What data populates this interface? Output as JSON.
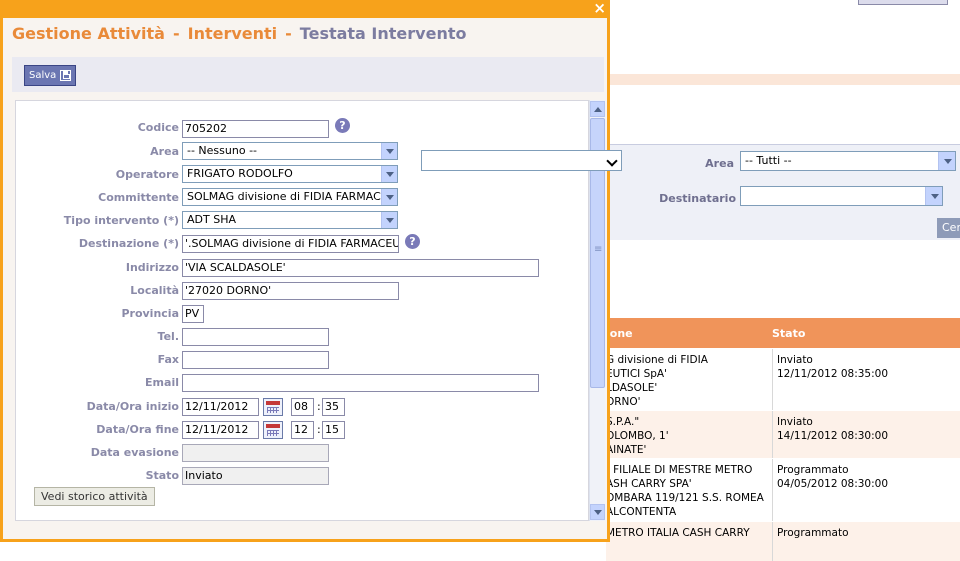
{
  "background": {
    "filter": {
      "area_label": "Area",
      "area_value": "-- Tutti --",
      "destinatario_label": "Destinatario",
      "destinatario_value": "",
      "search_button": "Cer"
    },
    "table": {
      "headers": [
        "ione",
        "Stato"
      ],
      "rows": [
        {
          "col1": [
            "G divisione di FIDIA",
            "EUTICI SpA'",
            "LDASOLE'",
            "ORNO'"
          ],
          "col2": [
            "Inviato",
            "12/11/2012 08:35:00"
          ]
        },
        {
          "col1": [
            "S.P.A.\"",
            "OLOMBO, 1'",
            "AINATE'"
          ],
          "col2": [
            "Inviato",
            "14/11/2012 08:30:00"
          ]
        },
        {
          "col1": [
            "- FILIALE DI MESTRE METRO",
            "ASH CARRY SPA'",
            "OMBARA 119/121 S.S. ROMEA",
            "ALCONTENTA"
          ],
          "col2": [
            "Programmato",
            "04/05/2012 08:30:00"
          ]
        },
        {
          "col1": [
            "METRO ITALIA CASH CARRY"
          ],
          "col2": [
            "Programmato"
          ]
        }
      ]
    }
  },
  "dialog": {
    "close_glyph": "×",
    "title": {
      "part1": "Gestione Attività",
      "part2": "Interventi",
      "part3": "Testata Intervento",
      "separator": "-"
    },
    "toolbar": {
      "save_label": "Salva"
    },
    "help_glyph": "?",
    "form": {
      "codice": {
        "label": "Codice",
        "value": "705202"
      },
      "area": {
        "label": "Area",
        "value": "-- Nessuno --"
      },
      "operatore": {
        "label": "Operatore",
        "value": "FRIGATO RODOLFO"
      },
      "committente": {
        "label": "Committente",
        "value": "SOLMAG divisione di FIDIA FARMACEU"
      },
      "tipo_intervento": {
        "label": "Tipo intervento (*)",
        "value": "ADT SHA"
      },
      "destinazione": {
        "label": "Destinazione (*)",
        "value": "'.SOLMAG divisione di FIDIA FARMACEUTICI S"
      },
      "indirizzo": {
        "label": "Indirizzo",
        "value": "'VIA SCALDASOLE'"
      },
      "localita": {
        "label": "Località",
        "value": "'27020 DORNO'"
      },
      "provincia": {
        "label": "Provincia",
        "value": "PV"
      },
      "tel": {
        "label": "Tel.",
        "value": ""
      },
      "fax": {
        "label": "Fax",
        "value": ""
      },
      "email": {
        "label": "Email",
        "value": ""
      },
      "data_inizio": {
        "label": "Data/Ora inizio",
        "date": "12/11/2012",
        "hour": "08",
        "minute": "35"
      },
      "data_fine": {
        "label": "Data/Ora fine",
        "date": "12/11/2012",
        "hour": "12",
        "minute": "15"
      },
      "data_evasione": {
        "label": "Data evasione",
        "value": ""
      },
      "stato": {
        "label": "Stato",
        "value": "Inviato"
      },
      "time_separator": ":",
      "history_button": "Vedi storico attività"
    }
  }
}
